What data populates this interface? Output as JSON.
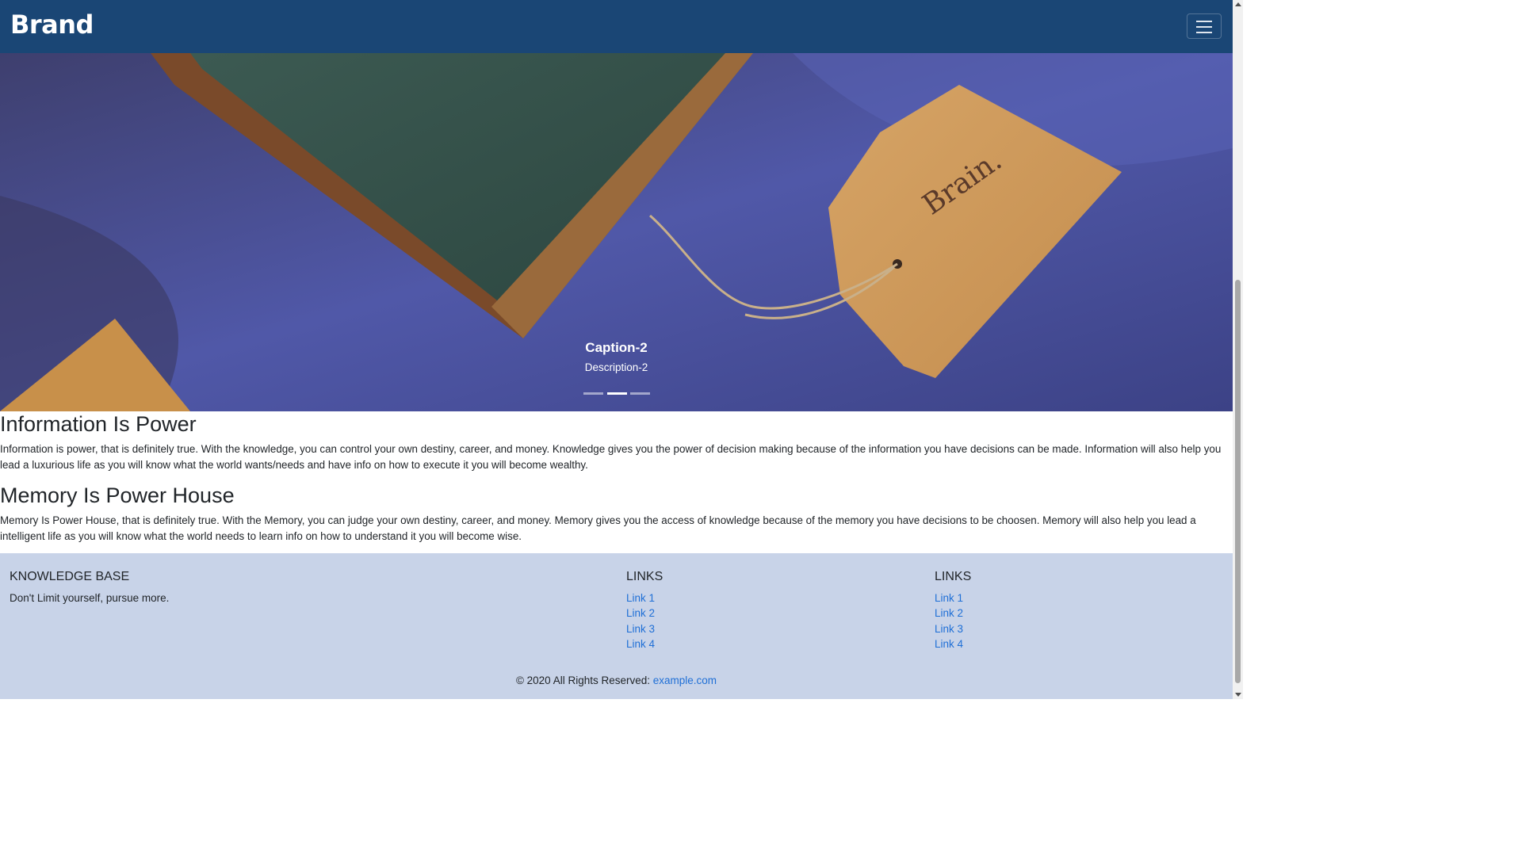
{
  "navbar": {
    "brand": "Brand",
    "toggler_icon": "hamburger-icon"
  },
  "carousel": {
    "caption_title": "Caption-2",
    "caption_description": "Description-2",
    "image_tag_text": "Brain.",
    "indicators": [
      {
        "active": false
      },
      {
        "active": true
      },
      {
        "active": false
      }
    ]
  },
  "sections": [
    {
      "heading": "Information Is Power",
      "text": "Information is power, that is definitely true. With the knowledge, you can control your own destiny, career, and money. Knowledge gives you the power of decision making because of the information you have decisions can be made. Information will also help you lead a luxurious life as you will know what the world wants/needs and have info on how to execute it you will become wealthy."
    },
    {
      "heading": "Memory Is Power House",
      "text": "Memory Is Power House, that is definitely true. With the Memory, you can judge your own destiny, career, and money. Memory gives you the access of knowledge because of the memory you have decisions to be choosen. Memory will also help you lead a intelligent life as you will know what the world needs to learn info on how to understand it you will become wise."
    }
  ],
  "footer": {
    "about_title": "KNOWLEDGE BASE",
    "about_text": "Don't Limit yourself, pursue more.",
    "links_col1": {
      "title": "LINKS",
      "items": [
        "Link 1",
        "Link 2",
        "Link 3",
        "Link 4"
      ]
    },
    "links_col2": {
      "title": "LINKS",
      "items": [
        "Link 1",
        "Link 2",
        "Link 3",
        "Link 4"
      ]
    },
    "copyright_prefix": "© 2020 All Rights Reserved: ",
    "copyright_link": "example.com"
  },
  "colors": {
    "navbar": "#1a4675",
    "footer": "#c8d3e8",
    "link": "#1f6fd6"
  }
}
